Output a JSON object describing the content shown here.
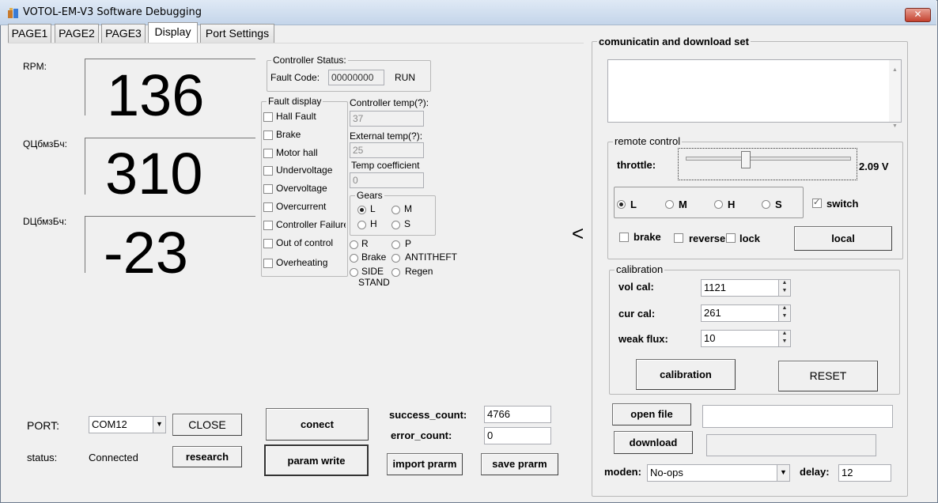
{
  "window": {
    "title": "VOTOL-EM-V3 Software Debugging",
    "close_label": "✕"
  },
  "tabs": [
    {
      "label": "PAGE1"
    },
    {
      "label": "PAGE2"
    },
    {
      "label": "PAGE3"
    },
    {
      "label": "Display"
    },
    {
      "label": "Port Settings"
    }
  ],
  "display": {
    "rpm_label": "RPM:",
    "rpm_value": "136",
    "q_label": "QЦбмзБч:",
    "q_value": "310",
    "d_label": "DЦбмзБч:",
    "d_value": "-23"
  },
  "controller_status": {
    "title": "Controller Status:",
    "fault_code_label": "Fault Code:",
    "fault_code": "00000000",
    "state": "RUN"
  },
  "fault_display": {
    "title": "Fault display",
    "items": [
      "Hall Fault",
      "Brake",
      "Motor hall",
      "Undervoltage",
      "Overvoltage",
      "Overcurrent",
      "Controller Failure",
      "Out of control",
      "Overheating"
    ]
  },
  "temps": {
    "controller_temp_label": "Controller temp(?):",
    "controller_temp": "37",
    "external_temp_label": "External temp(?):",
    "external_temp": "25",
    "temp_coeff_label": "Temp coefficient",
    "temp_coeff": "0"
  },
  "gears": {
    "title": "Gears",
    "options": [
      "L",
      "M",
      "H",
      "S"
    ],
    "selected": "L",
    "modes": [
      "R",
      "P",
      "Brake",
      "ANTITHEFT",
      "SIDE",
      "Regen"
    ],
    "side_line2": "STAND"
  },
  "port": {
    "port_label": "PORT:",
    "port_value": "COM12",
    "close_button": "CLOSE",
    "status_label": "status:",
    "status_value": "Connected",
    "research_button": "research"
  },
  "actions": {
    "connect": "conect",
    "param_write": "param write",
    "import": "import prarm",
    "save": "save prarm"
  },
  "counts": {
    "success_label": "success_count:",
    "success": "4766",
    "error_label": "error_count:",
    "error": "0"
  },
  "collapse_glyph": "<",
  "comm": {
    "title": "comunicatin and download set"
  },
  "remote": {
    "title": "remote control",
    "throttle_label": "throttle:",
    "throttle_fraction": 0.36,
    "throttle_value": "2.09  V",
    "gear_options": [
      "L",
      "M",
      "H",
      "S"
    ],
    "gear_selected": "L",
    "switch_label": "switch",
    "switch_checked": true,
    "brake_label": "brake",
    "reverse_label": "reverse",
    "lock_label": "lock",
    "local_button": "local"
  },
  "calibration": {
    "title": "calibration",
    "vol_label": "vol cal:",
    "vol": "1121",
    "cur_label": "cur cal:",
    "cur": "261",
    "flux_label": "weak flux:",
    "flux": "10",
    "calibration_button": "calibration",
    "reset_button": "RESET"
  },
  "files": {
    "open_button": "open file",
    "open_path": "",
    "download_button": "download",
    "download_path": ""
  },
  "bottom": {
    "moden_label": "moden:",
    "moden_value": "No-ops",
    "delay_label": "delay:",
    "delay_value": "12"
  }
}
